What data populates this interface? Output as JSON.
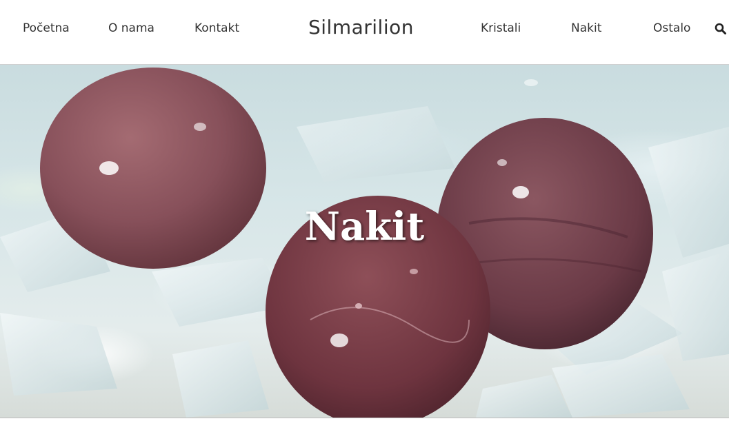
{
  "header": {
    "nav_left": [
      "Početna",
      "O nama",
      "Kontakt"
    ],
    "site_title": "Silmarilion",
    "nav_right": [
      "Kristali",
      "Nakit",
      "Ostalo"
    ],
    "search_icon": "search-icon"
  },
  "hero": {
    "title": "Nakit",
    "image": "red aventurine tumbled stones on clear quartz crystals"
  },
  "colors": {
    "text": "#333333",
    "hero_title": "#ffffff",
    "stone": "#7a3d48"
  }
}
